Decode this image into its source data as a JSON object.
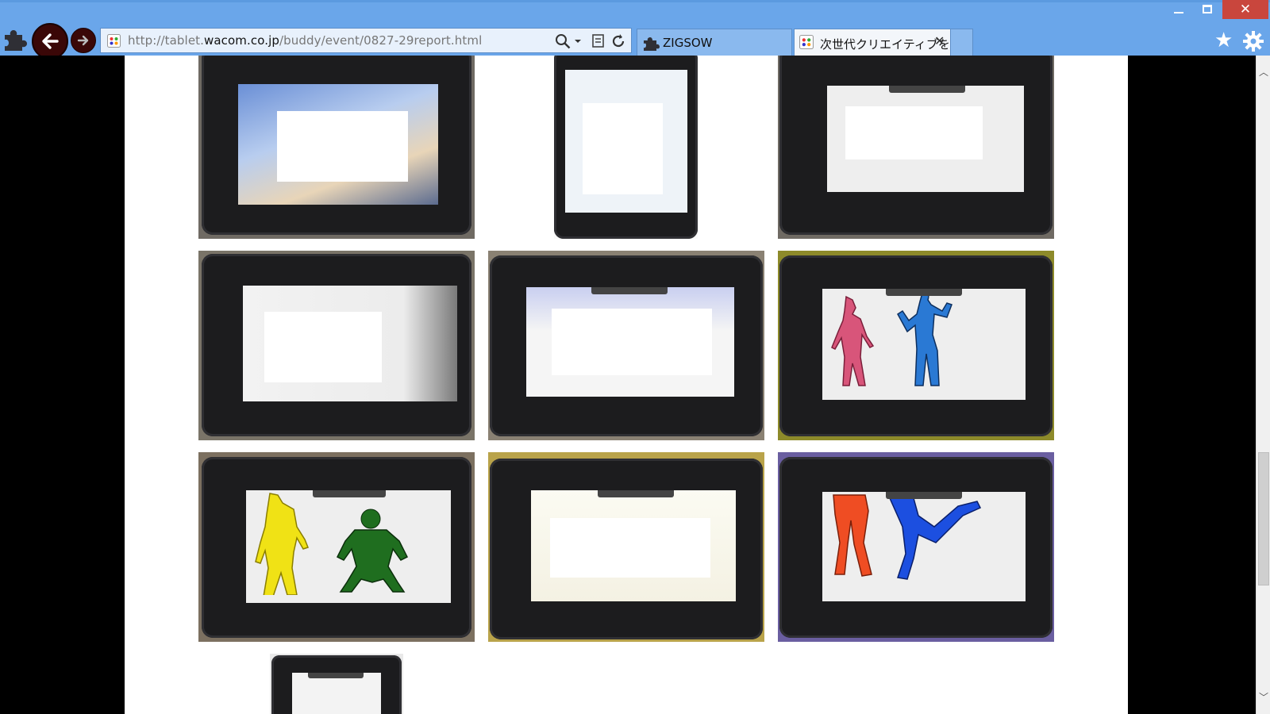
{
  "browser": {
    "address_url_prefix": "http://tablet.",
    "address_url_domain": "wacom.co.jp",
    "address_url_path": "/buddy/event/0827-29report.html",
    "tabs": [
      {
        "label": "ZIGSOW",
        "active": false
      },
      {
        "label": "次世代クリエイティブを...",
        "active": true
      }
    ],
    "window_controls": {
      "minimize": "—",
      "close": "✕"
    },
    "accent_color": "#6aa6ea"
  },
  "gallery": {
    "photos": [
      {
        "id": "photo-1",
        "subject": "tablet with blurred blue drawing",
        "redacted": true
      },
      {
        "id": "photo-2",
        "subject": "small tablet with sketch",
        "redacted": true
      },
      {
        "id": "photo-3",
        "subject": "tablet with grey sketch",
        "redacted": true
      },
      {
        "id": "photo-4",
        "subject": "tablet with pencil sketch",
        "redacted": true
      },
      {
        "id": "photo-5",
        "subject": "tablet with colorful doodle",
        "redacted": true
      },
      {
        "id": "photo-6",
        "subject": "tablet with pink and blue figures",
        "redacted": false
      },
      {
        "id": "photo-7",
        "subject": "tablet with yellow and green figures",
        "redacted": false
      },
      {
        "id": "photo-8",
        "subject": "tablet with colorful doodle",
        "redacted": true
      },
      {
        "id": "photo-9",
        "subject": "tablet with orange and blue legs",
        "redacted": false
      },
      {
        "id": "photo-10",
        "subject": "partially visible tablet",
        "redacted": false
      }
    ]
  }
}
